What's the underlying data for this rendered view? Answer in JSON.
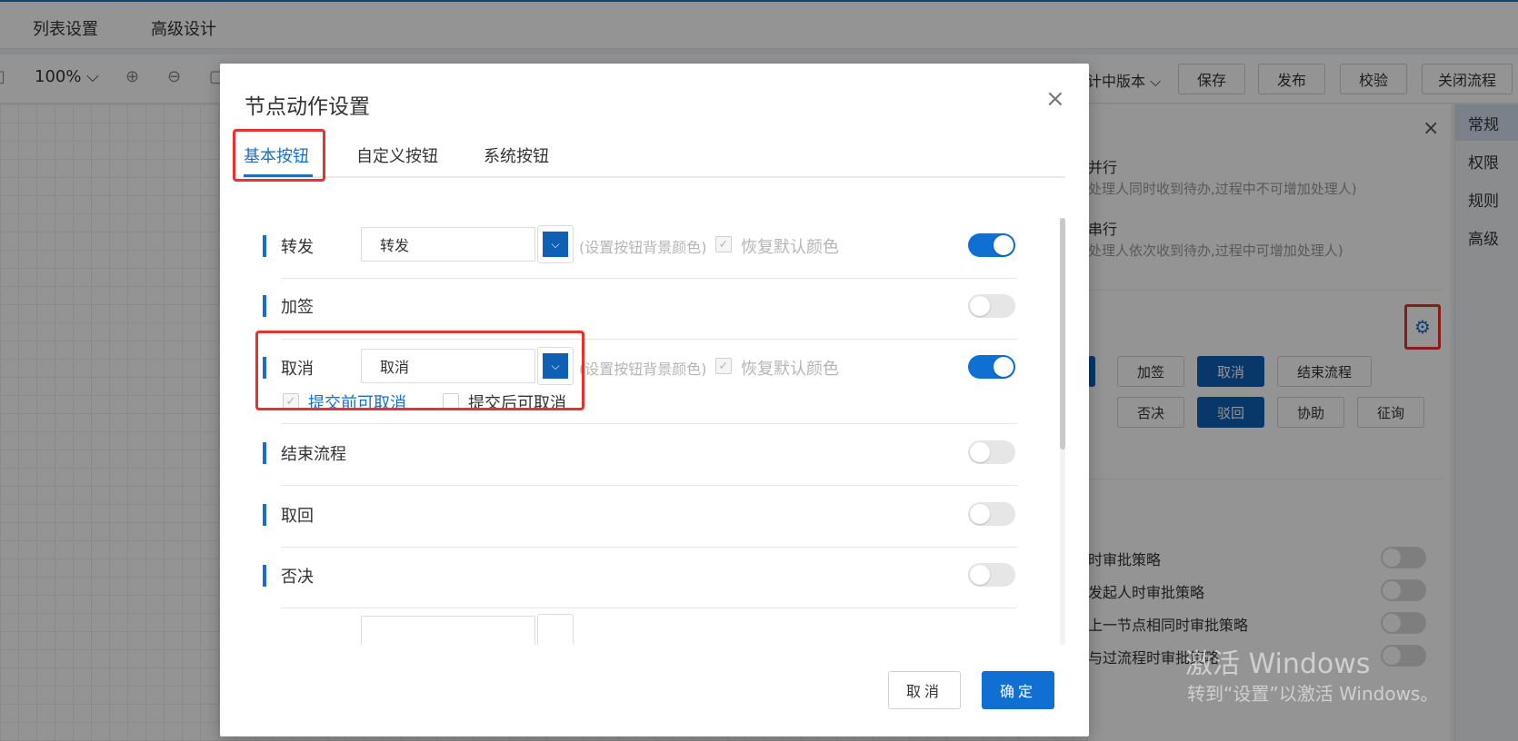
{
  "topnav": {
    "items": [
      "列表设置",
      "高级设计"
    ]
  },
  "toolbar": {
    "zoom": "100% ⌵",
    "version_label": "计中版本 ⌵",
    "buttons": [
      "保存",
      "发布",
      "校验",
      "关闭流程"
    ]
  },
  "right_panel": {
    "close": "×",
    "parallel": {
      "title": "并行",
      "desc": "处理人同时收到待办,过程中不可增加处理人)"
    },
    "serial": {
      "title": "串行",
      "desc": "处理人依次收到待办,过程中可增加处理人)"
    },
    "buttons_row1": [
      "加签",
      "取消",
      "结束流程"
    ],
    "buttons_row2": [
      "否决",
      "驳回",
      "协助",
      "征询"
    ],
    "strategies": [
      "时审批策略",
      "发起人时审批策略",
      "上一节点相同时审批策略",
      "与过流程时审批策略"
    ],
    "accent_color": "#0f5fb5"
  },
  "side_tabs": [
    "常规",
    "权限",
    "规则",
    "高级"
  ],
  "watermark": {
    "line1": "激活 Windows",
    "line2": "转到“设置”以激活 Windows。"
  },
  "modal": {
    "title": "节点动作设置",
    "close": "×",
    "tabs": [
      "基本按钮",
      "自定义按钮",
      "系统按钮"
    ],
    "active_tab": "基本按钮",
    "hint": "(设置按钮背景颜色)",
    "restore_label": "恢复默认颜色",
    "rows": [
      {
        "label": "转发",
        "value": "转发",
        "enabled": true
      },
      {
        "label": "加签",
        "enabled": false
      },
      {
        "label": "取消",
        "value": "取消",
        "enabled": true
      },
      {
        "label": "结束流程",
        "enabled": false
      },
      {
        "label": "取回",
        "enabled": false
      },
      {
        "label": "否决",
        "enabled": false
      }
    ],
    "cancel_options": {
      "before": "提交前可取消",
      "after": "提交后可取消"
    },
    "footer": {
      "cancel": "取消",
      "ok": "确定"
    },
    "accent_color": "#1a6fc4"
  }
}
